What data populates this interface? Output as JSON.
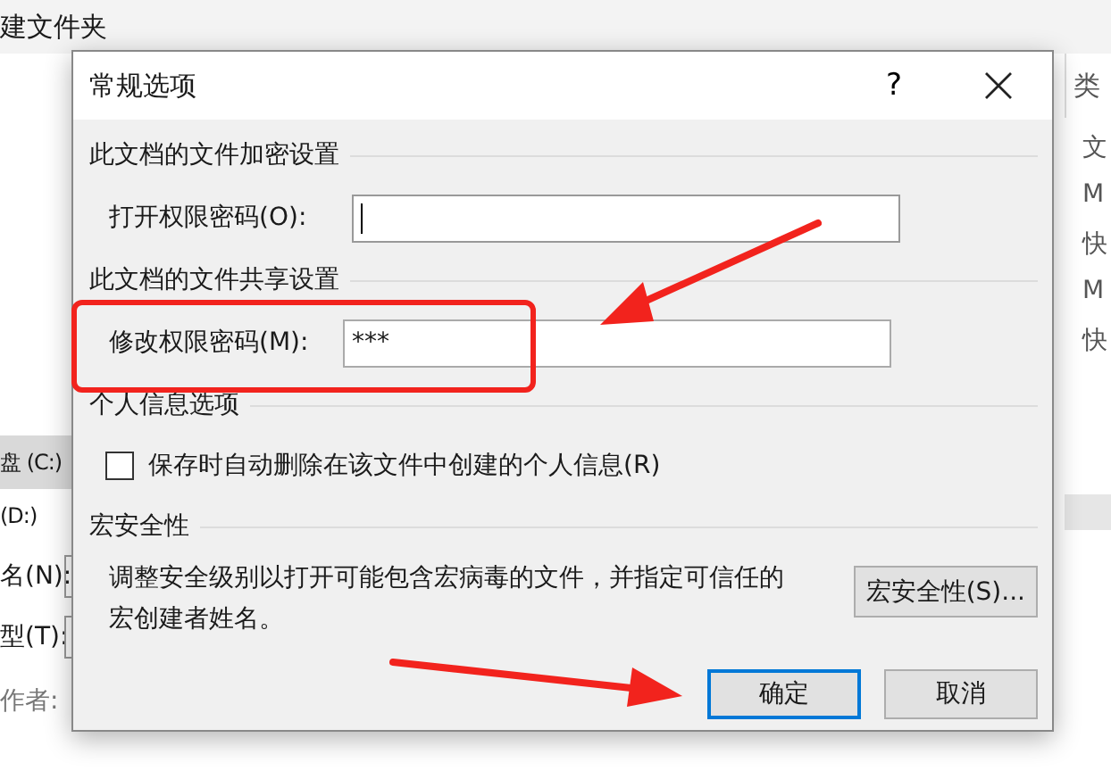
{
  "background_window": {
    "toolbar_item": "建文件夹",
    "nav_items": [
      {
        "label": "盘 (C:)",
        "selected": true
      },
      {
        "label": "(D:)",
        "selected": false
      }
    ],
    "fields": [
      {
        "label": "名(N):"
      },
      {
        "label": "型(T):"
      }
    ],
    "author_label": "作者:",
    "right_header": "类",
    "right_items": [
      "文",
      "M",
      "快",
      "M",
      "快"
    ]
  },
  "dialog": {
    "title": "常规选项",
    "help": "?",
    "sections": [
      {
        "title": "此文档的文件加密设置",
        "kind": "password",
        "label": "打开权限密码(O):",
        "focused": true
      },
      {
        "title": "此文档的文件共享设置",
        "kind": "password",
        "label": "修改权限密码(M):",
        "value": "***",
        "focused": false
      },
      {
        "title": "个人信息选项",
        "kind": "checkbox",
        "label": "保存时自动删除在该文件中创建的个人信息(R)",
        "checked": false
      },
      {
        "title": "宏安全性",
        "kind": "macro",
        "text": "调整安全级别以打开可能包含宏病毒的文件，并指定可信任的宏创建者姓名。",
        "button": "宏安全性(S)..."
      }
    ],
    "buttons": [
      {
        "label": "确定",
        "default": true
      },
      {
        "label": "取消",
        "default": false
      }
    ]
  }
}
